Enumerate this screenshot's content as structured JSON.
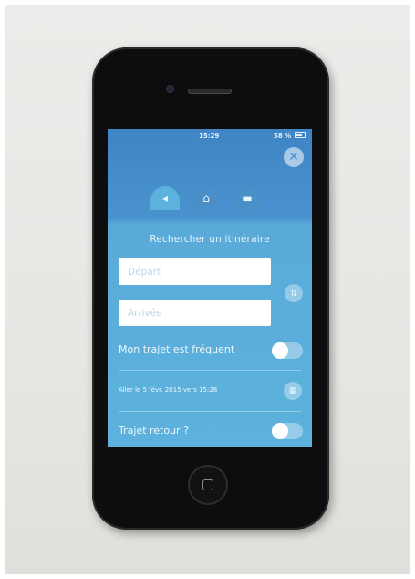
{
  "status_bar": {
    "time": "15:29",
    "battery": "58 %"
  },
  "close_glyph": "✕",
  "tabs": [
    {
      "name": "walk",
      "glyph": "◂"
    },
    {
      "name": "monument",
      "glyph": "⌂"
    },
    {
      "name": "tickets",
      "glyph": "▬"
    }
  ],
  "form": {
    "title": "Rechercher un itinéraire",
    "depart_placeholder": "Départ",
    "arrivee_placeholder": "Arrivée",
    "swap_glyph": "⇅",
    "frequent_label": "Mon trajet est fréquent",
    "frequent_on": false,
    "date_label": "Aller le 5 févr. 2015 vers 15:28",
    "calendar_glyph": "▦",
    "return_label": "Trajet retour ?",
    "return_on": false
  },
  "home_button_glyph": ""
}
